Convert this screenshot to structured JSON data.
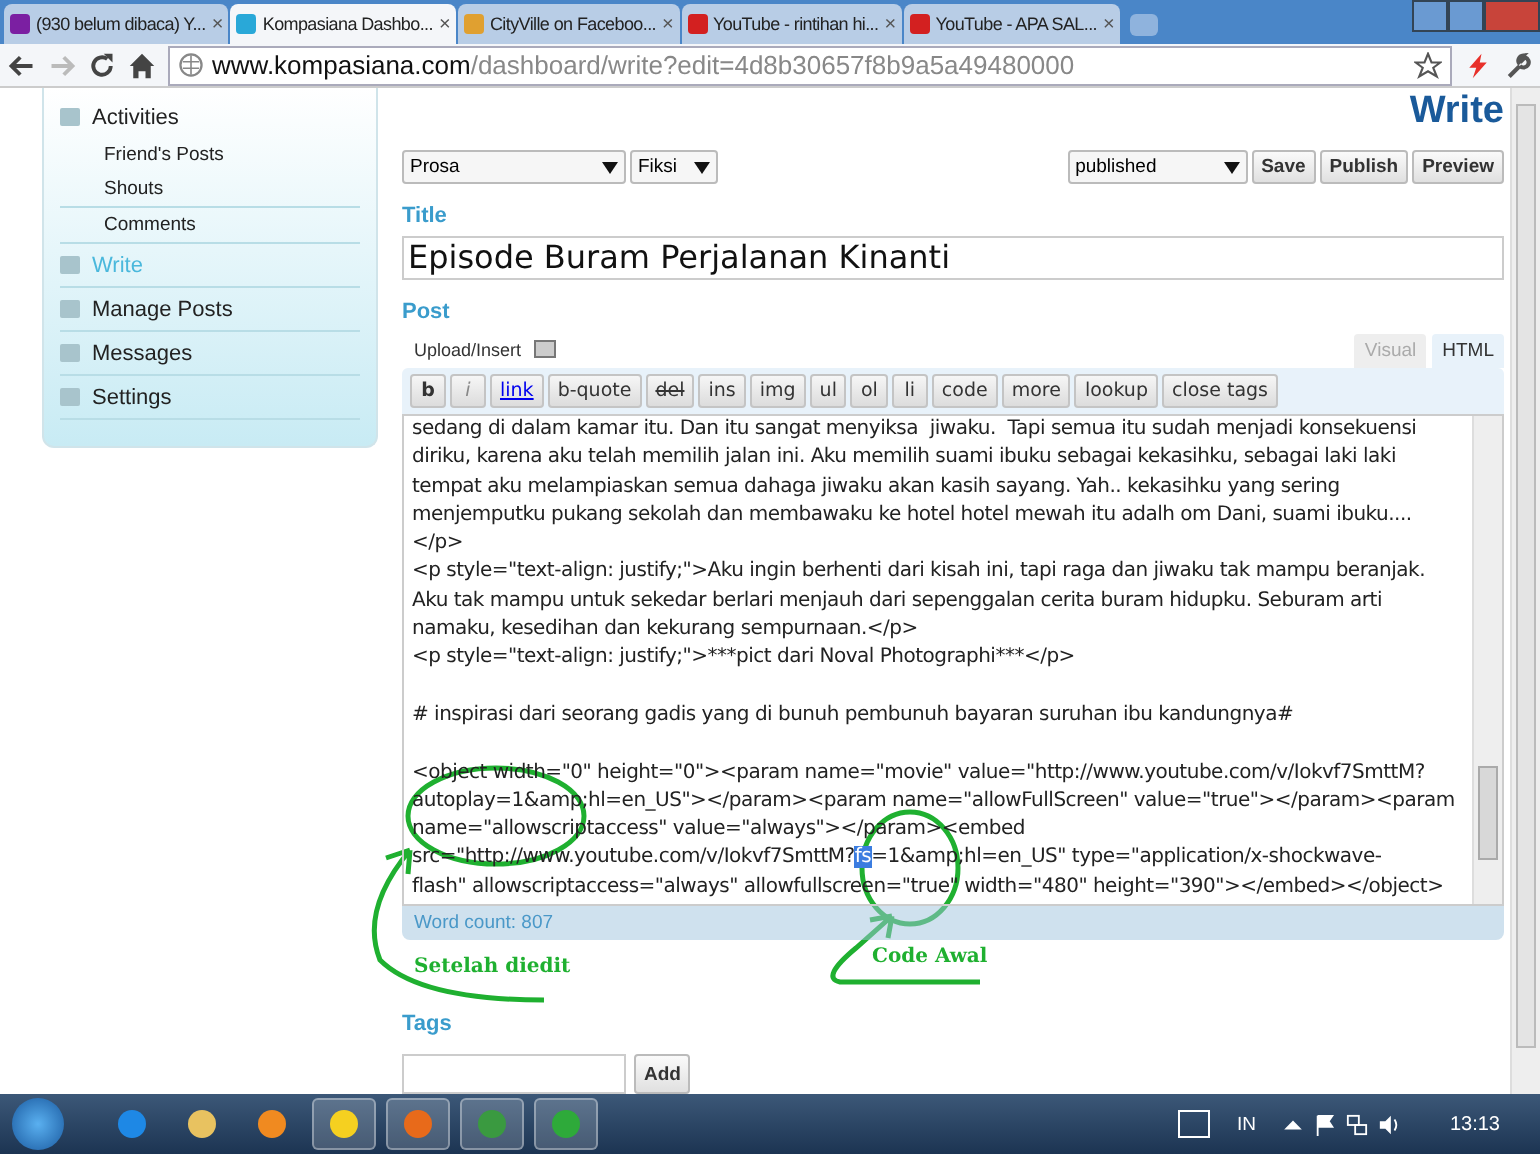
{
  "browser": {
    "tabs": [
      {
        "label": "(930 belum dibaca) Y...",
        "close": "×",
        "selected": false
      },
      {
        "label": "Kompasiana Dashbo...",
        "close": "×",
        "selected": true
      },
      {
        "label": "CityVille on Faceboo...",
        "close": "×",
        "selected": false
      },
      {
        "label": "YouTube - rintihan hi...",
        "close": "×",
        "selected": false
      },
      {
        "label": "YouTube - APA SAL...",
        "close": "×",
        "selected": false
      }
    ],
    "address": {
      "host": "www.kompasiana.com",
      "path": "/dashboard/write?edit=4d8b30657f8b9a5a49480000"
    }
  },
  "sidebar": {
    "items": [
      {
        "label": "Activities",
        "selected": false,
        "children": [
          {
            "label": "Friend's Posts"
          },
          {
            "label": "Shouts"
          },
          {
            "label": "Comments"
          }
        ]
      },
      {
        "label": "Write",
        "selected": true
      },
      {
        "label": "Manage Posts",
        "selected": false
      },
      {
        "label": "Messages",
        "selected": false
      },
      {
        "label": "Settings",
        "selected": false
      }
    ]
  },
  "page_title": "Write",
  "selects": {
    "category": "Prosa",
    "subcategory": "Fiksi",
    "status": "published"
  },
  "actions": [
    "Save",
    "Publish",
    "Preview"
  ],
  "title_label": "Title",
  "title_value": "Episode Buram Perjalanan Kinanti",
  "post_label": "Post",
  "upload_label": "Upload/Insert",
  "editor_tabs": [
    {
      "label": "Visual",
      "selected": false
    },
    {
      "label": "HTML",
      "selected": true
    }
  ],
  "toolbar": [
    {
      "label": "b",
      "kind": "bold"
    },
    {
      "label": "i",
      "kind": "italic"
    },
    {
      "label": "link",
      "kind": "link"
    },
    {
      "label": "b-quote",
      "kind": "plain"
    },
    {
      "label": "del",
      "kind": "strike"
    },
    {
      "label": "ins",
      "kind": "plain"
    },
    {
      "label": "img",
      "kind": "plain"
    },
    {
      "label": "ul",
      "kind": "plain"
    },
    {
      "label": "ol",
      "kind": "plain"
    },
    {
      "label": "li",
      "kind": "plain"
    },
    {
      "label": "code",
      "kind": "plain"
    },
    {
      "label": "more",
      "kind": "plain"
    },
    {
      "label": "lookup",
      "kind": "plain"
    },
    {
      "label": "close tags",
      "kind": "plain"
    }
  ],
  "editor_lines": [
    {
      "text": "sedang di dalam kamar itu. Dan itu sangat menyiksa  jiwaku.  Tapi semua itu sudah menjadi konsekuensi"
    },
    {
      "text": "diriku, karena aku telah memilih jalan ini. Aku memilih suami ibuku sebagai kekasihku, sebagai laki laki"
    },
    {
      "text": "tempat aku melampiaskan semua dahaga jiwaku akan kasih sayang. Yah.. kekasihku yang sering"
    },
    {
      "text": "menjemputku pukang sekolah dan membawaku ke hotel hotel mewah itu adalh om Dani, suami ibuku...."
    },
    {
      "text": "</p>"
    },
    {
      "text": "<p style=\"text-align: justify;\">Aku ingin berhenti dari kisah ini, tapi raga dan jiwaku tak mampu beranjak."
    },
    {
      "text": "Aku tak mampu untuk sekedar berlari menjauh dari sepenggalan cerita buram hidupku. Seburam arti"
    },
    {
      "text": "namaku, kesedihan dan kekurang sempurnaan.</p>"
    },
    {
      "text": "<p style=\"text-align: justify;\">***pict dari Noval Photographi***</p>"
    },
    {
      "text": "# inspirasi dari seorang gadis yang di bunuh pembunuh bayaran suruhan ibu kandungnya#",
      "gap_before": true
    },
    {
      "text": "<object width=\"0\" height=\"0\"><param name=\"movie\" value=\"http://www.youtube.com/v/Iokvf7SmttM?",
      "gap_before": true
    },
    {
      "text": "autoplay=1&amp;hl=en_US\"></param><param name=\"allowFullScreen\" value=\"true\"></param><param"
    },
    {
      "text": "name=\"allowscriptaccess\" value=\"always\"></param><embed"
    },
    {
      "text": "src=\"http://www.youtube.com/v/Iokvf7SmttM?",
      "selection": "fs",
      "after": "=1&amp;hl=en_US\" type=\"application/x-shockwave-"
    },
    {
      "text": "flash\" allowscriptaccess=\"always\" allowfullscreen=\"true\" width=\"480\" height=\"390\"></embed></object>"
    }
  ],
  "word_count": "Word count: 807",
  "annotations": [
    {
      "label": "Setelah diedit"
    },
    {
      "label": "Code Awal"
    }
  ],
  "tags_label": "Tags",
  "tags_button": "Add",
  "taskbar": {
    "apps": [
      {
        "running": false
      },
      {
        "running": false
      },
      {
        "running": false
      },
      {
        "running": true
      },
      {
        "running": true
      },
      {
        "running": true
      },
      {
        "running": true
      }
    ],
    "language": "IN",
    "time": "13:13"
  }
}
